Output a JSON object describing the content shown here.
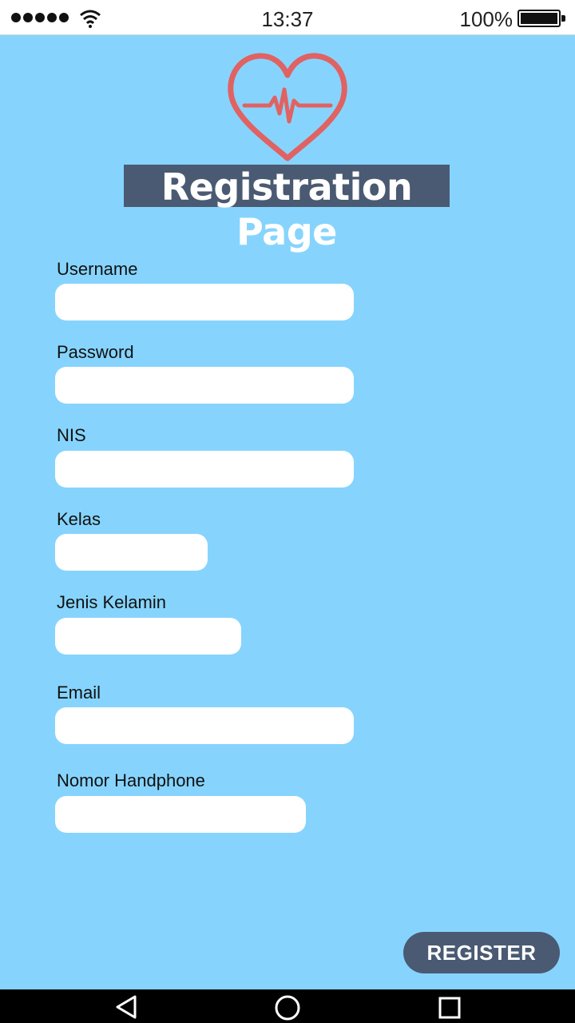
{
  "status_bar": {
    "time": "13:37",
    "battery": "100%"
  },
  "header": {
    "title": "Registration Page",
    "logo_icon": "heart-pulse-icon",
    "logo_color": "#e06262"
  },
  "form": {
    "fields": [
      {
        "label": "Username",
        "value": ""
      },
      {
        "label": "Password",
        "value": ""
      },
      {
        "label": "NIS",
        "value": ""
      },
      {
        "label": "Kelas",
        "value": ""
      },
      {
        "label": "Jenis Kelamin",
        "value": ""
      },
      {
        "label": "Email",
        "value": ""
      },
      {
        "label": "Nomor Handphone",
        "value": ""
      }
    ],
    "register_label": "REGISTER"
  },
  "colors": {
    "background": "#86d4fd",
    "accent": "#4a5a72",
    "field": "#ffffff"
  },
  "nav_bar": {
    "back_icon": "back-triangle-icon",
    "home_icon": "home-circle-icon",
    "recent_icon": "recent-square-icon"
  }
}
